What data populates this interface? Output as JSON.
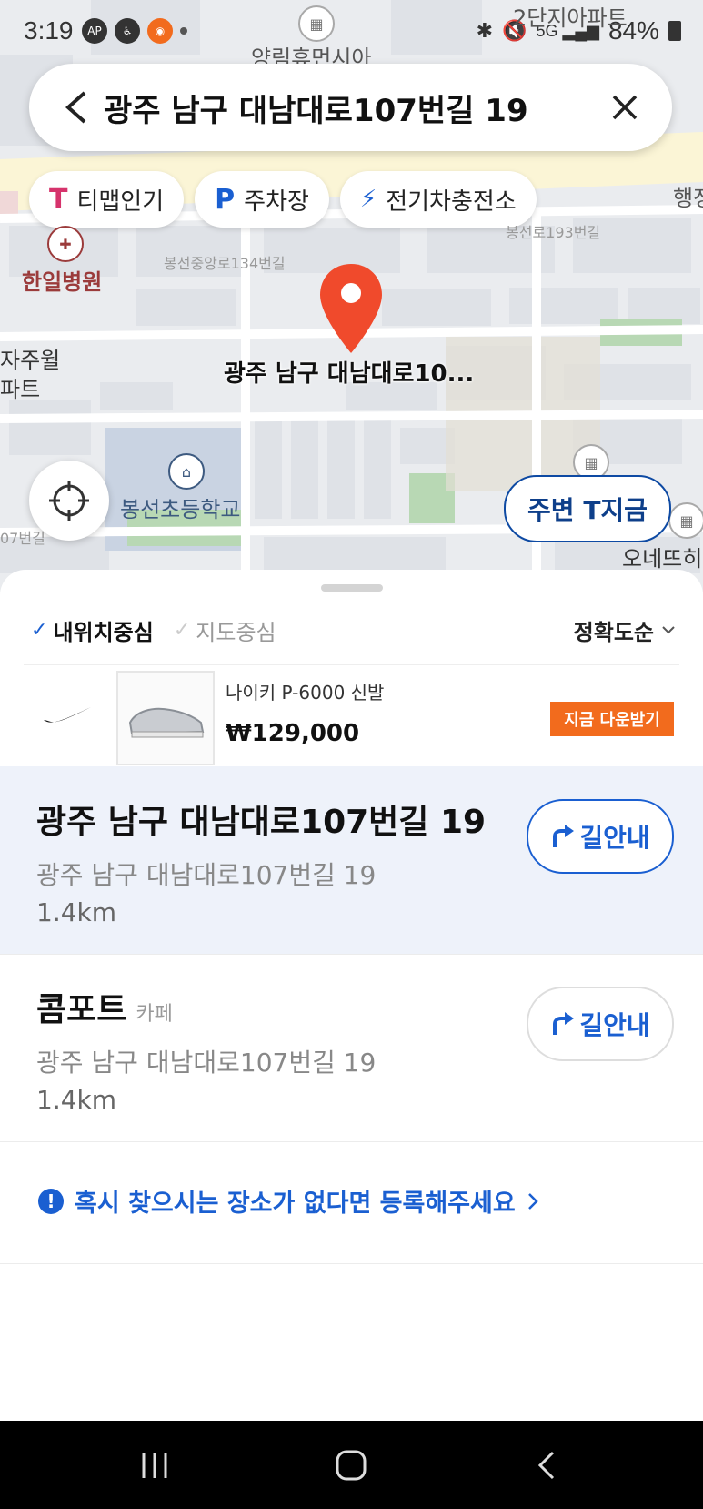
{
  "status_bar": {
    "time": "3:19",
    "battery": "84%"
  },
  "map": {
    "labels": {
      "apt_top": "양림휴먼시아",
      "apt_top_right": "2단지아파트",
      "hospital": "한일병원",
      "apt_left_1": "자주월",
      "apt_left_2": "파트",
      "school": "봉선초등학교",
      "road_1": "봉선중앙로134번길",
      "road_2": "봉선로193번길",
      "road_3": "07번길",
      "right_1": "행정",
      "right_2": "오네뜨히"
    },
    "pin_label": "광주 남구 대남대로10...",
    "nearby_button": "주변 T지금"
  },
  "search": {
    "query": "광주 남구 대남대로107번길 19"
  },
  "chips": [
    {
      "icon": "T",
      "label": "티맵인기"
    },
    {
      "icon": "P",
      "label": "주차장"
    },
    {
      "icon": "⚡",
      "label": "전기차충전소"
    }
  ],
  "filters": {
    "my_location": "내위치중심",
    "map_center": "지도중심",
    "sort": "정확도순"
  },
  "ad": {
    "title": "나이키 P-6000 신발",
    "price": "₩129,000",
    "cta": "지금 다운받기"
  },
  "results": [
    {
      "name": "광주 남구 대남대로107번길 19",
      "category": "",
      "address": "광주 남구 대남대로107번길 19",
      "distance": "1.4km",
      "nav_label": "길안내"
    },
    {
      "name": "콤포트",
      "category": "카페",
      "address": "광주 남구 대남대로107번길 19",
      "distance": "1.4km",
      "nav_label": "길안내"
    }
  ],
  "register_prompt": "혹시 찾으시는 장소가 없다면 등록해주세요"
}
